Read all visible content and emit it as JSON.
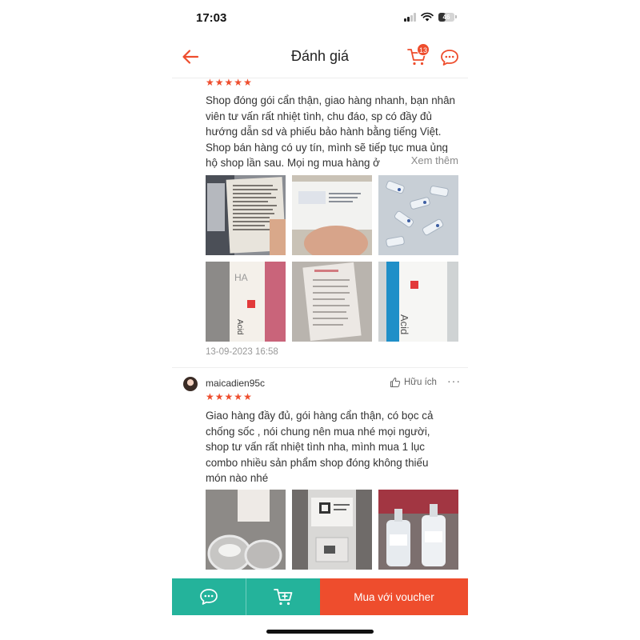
{
  "status_bar": {
    "time": "17:03",
    "battery": "46"
  },
  "header": {
    "title": "Đánh giá",
    "cart_badge": "13"
  },
  "reviews": [
    {
      "stars": 5,
      "text": "Shop đóng gói cẩn thận, giao hàng nhanh, bạn nhân viên tư vấn rất nhiệt tình, chu đáo, sp có đầy đủ hướng dẫn sd và phiếu bảo hành bằng tiếng Việt. Shop bán hàng có uy tín, mình sẽ tiếp tục mua ủng hộ shop lần sau. Mọi ng mua hàng ở",
      "see_more": "Xem thêm",
      "date": "13-09-2023 16:58",
      "photos": [
        "laptop-leaflet-photo",
        "box-label-photo",
        "ampoules-photo",
        "ha-bottle-photo",
        "packing-slip-photo",
        "acid-box-photo"
      ]
    },
    {
      "username": "maicadien95c",
      "helpful": "Hữu ích",
      "stars": 5,
      "text": "Giao hàng đầy đủ, gói hàng cẩn thận, có bọc cả chống sốc , nói chung nên mua nhé mọi người, shop tư vấn rất nhiệt tình nha, mình mua 1 lục combo nhiều sản phẩm shop đóng không thiếu món nào nhé",
      "photos": [
        "jars-photo",
        "qr-bottle-photo",
        "dropper-bottles-photo"
      ]
    }
  ],
  "bottom_bar": {
    "buy_label": "Mua với voucher"
  },
  "colors": {
    "accent": "#ee4d2d",
    "teal": "#24b39b"
  }
}
